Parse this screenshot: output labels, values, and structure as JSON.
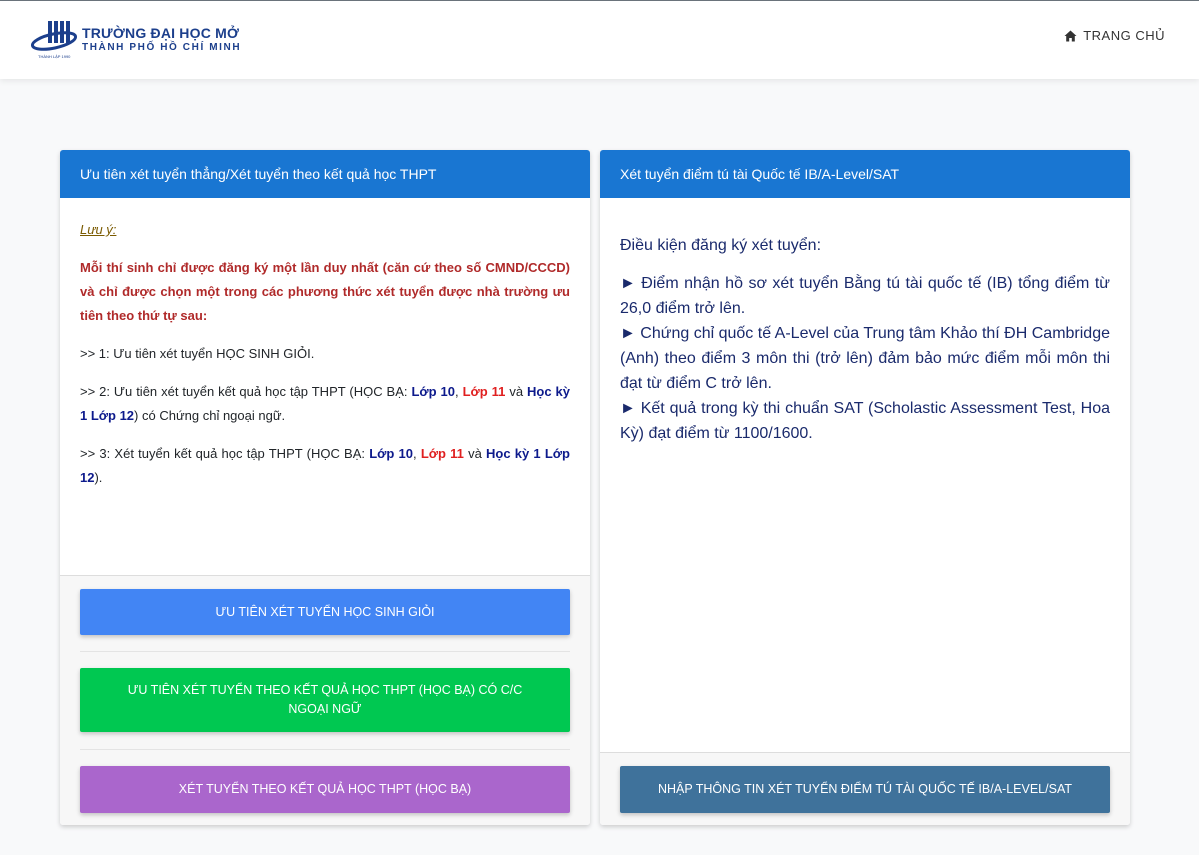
{
  "header": {
    "brand_name": "TRƯỜNG ĐẠI HỌC MỞ",
    "brand_sub": "THÀNH PHỐ HỒ CHÍ MINH",
    "brand_tiny": "THÀNH LẬP 1990",
    "home_label": "TRANG CHỦ",
    "icons": {
      "home": "home-icon",
      "logo": "university-logo"
    },
    "colors": {
      "brand": "#1c3f8c"
    }
  },
  "left_card": {
    "title": "Ưu tiên xét tuyển thẳng/Xét tuyển theo kết quả học THPT",
    "note_label": "Lưu ý:",
    "notice": "Mỗi thí sinh chỉ được đăng ký một lần duy nhất  (căn cứ theo số CMND/CCCD) và chỉ được chọn một trong các phương thức xét tuyển được nhà trường ưu tiên theo thứ tự sau:",
    "option1": ">>  1: Ưu tiên xét tuyển HỌC SINH GIỎI.",
    "option2": {
      "prefix": ">>  2: Ưu tiên xét tuyển kết quả học tập THPT (HỌC BẠ: ",
      "lop10": "Lớp 10",
      "comma": ", ",
      "lop11": "Lớp 11",
      "and": " và ",
      "hk1lop12": "Học kỳ 1 Lớp 12",
      "suffix": ") có Chứng chỉ ngoại ngữ."
    },
    "option3": {
      "prefix": ">>  3: Xét tuyển kết quả học tập THPT (HỌC BẠ: ",
      "lop10": "Lớp 10",
      "comma": ", ",
      "lop11": "Lớp 11",
      "and": " và ",
      "hk1lop12": "Học kỳ 1 Lớp 12",
      "suffix": ")."
    },
    "buttons": {
      "gifted": "ƯU TIÊN XÉT TUYỂN HỌC SINH GIỎI",
      "transcript_cert": "ƯU TIÊN XÉT TUYỂN THEO KẾT QUẢ HỌC THPT (HỌC BẠ) CÓ C/C NGOẠI NGỮ",
      "transcript": "XÉT TUYỂN THEO KẾT QUẢ HỌC THPT (HỌC BẠ)"
    },
    "colors": {
      "header": "#1976d2",
      "btn_gifted": "#4285f4",
      "btn_cert": "#00c851",
      "btn_transcript": "#aa66cc"
    }
  },
  "right_card": {
    "title": "Xét tuyển điểm tú tài Quốc tế IB/A-Level/SAT",
    "condition_label": "Điều kiện đăng ký xét tuyển:",
    "items": [
      "► Điểm nhận hồ sơ xét tuyển Bằng tú tài quốc tế (IB) tổng điểm từ 26,0 điểm trở lên.",
      "► Chứng chỉ quốc tế A-Level của Trung tâm Khảo thí ĐH Cambridge (Anh) theo điểm 3 môn thi (trở lên) đảm bảo mức điểm mỗi môn thi đạt từ điểm C trở lên.",
      "► Kết quả trong kỳ thi chuẩn SAT (Scholastic Assessment Test, Hoa Kỳ) đạt điểm từ 1100/1600."
    ],
    "button": "NHẬP THÔNG TIN XÉT TUYỂN ĐIỂM TÚ TÀI QUỐC TẾ IB/A-LEVEL/SAT",
    "colors": {
      "button": "#3f729b"
    }
  }
}
